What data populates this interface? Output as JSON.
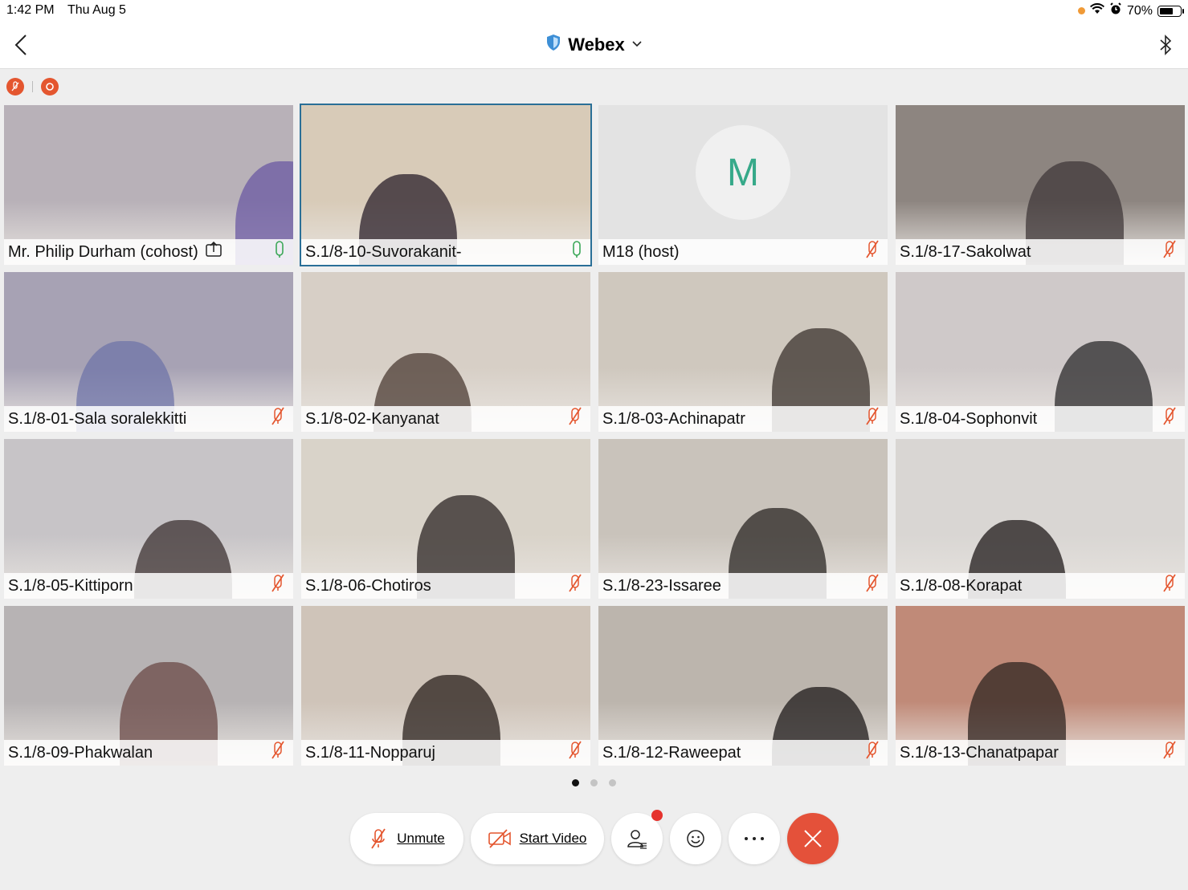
{
  "status_bar": {
    "time": "1:42 PM",
    "date": "Thu Aug 5",
    "battery": "70%",
    "battery_level": 0.7
  },
  "nav": {
    "title": "Webex"
  },
  "colors": {
    "accent_blue": "#2a6f97",
    "mute_red": "#e4562f",
    "unmuted_green": "#3aa757",
    "end_red": "#e4513a",
    "avatar_teal": "#36a989",
    "badge_red": "#e5322d",
    "status_orange": "#f09a37"
  },
  "participants": [
    {
      "name": "Mr. Philip Durham (cohost)",
      "mic": "on",
      "sharing": true,
      "bg": "#b8b1b8",
      "accent": "#6b5aa3"
    },
    {
      "name": "S.1/8-10-Suvorakanit-",
      "mic": "on",
      "active": true,
      "bg": "#d8cbb8",
      "accent": "#2a1f2a"
    },
    {
      "name": "M18 (host)",
      "mic": "muted",
      "avatar": "M",
      "bg": "#e3e3e3"
    },
    {
      "name": "S.1/8-17-Sakolwat",
      "mic": "muted",
      "bg": "#8d8580",
      "accent": "#40383a"
    },
    {
      "name": "S.1/8-01-Sala soralekkitti",
      "mic": "muted",
      "bg": "#a7a2b4",
      "accent": "#6f74a8"
    },
    {
      "name": "S.1/8-02-Kanyanat",
      "mic": "muted",
      "bg": "#d7cfc6",
      "accent": "#4b3b33"
    },
    {
      "name": "S.1/8-03-Achinapatr",
      "mic": "muted",
      "bg": "#cfc8be",
      "accent": "#3b332d"
    },
    {
      "name": "S.1/8-04-Sophonvit",
      "mic": "muted",
      "bg": "#cfc9c9",
      "accent": "#2b2a2b"
    },
    {
      "name": "S.1/8-05-Kittiporn",
      "mic": "muted",
      "bg": "#c7c4c7",
      "accent": "#3c3232"
    },
    {
      "name": "S.1/8-06-Chotiros",
      "mic": "muted",
      "bg": "#d9d3c9",
      "accent": "#2c2624"
    },
    {
      "name": "S.1/8-23-Issaree",
      "mic": "muted",
      "bg": "#c9c3bb",
      "accent": "#2a2523"
    },
    {
      "name": "S.1/8-08-Korapat",
      "mic": "muted",
      "bg": "#d9d6d3",
      "accent": "#1f1a19"
    },
    {
      "name": "S.1/8-09-Phakwalan",
      "mic": "muted",
      "bg": "#b7b3b4",
      "accent": "#6b4a47"
    },
    {
      "name": "S.1/8-11-Nopparuj",
      "mic": "muted",
      "bg": "#cfc4b9",
      "accent": "#2a201c"
    },
    {
      "name": "S.1/8-12-Raweepat",
      "mic": "muted",
      "bg": "#bcb5ad",
      "accent": "#1d1a1a"
    },
    {
      "name": "S.1/8-13-Chanatpapar",
      "mic": "muted",
      "bg": "#c08a78",
      "accent": "#2f2420"
    }
  ],
  "pager": {
    "pages": 3,
    "current": 1
  },
  "controls": {
    "unmute_label": "Unmute",
    "start_video_label": "Start Video"
  }
}
